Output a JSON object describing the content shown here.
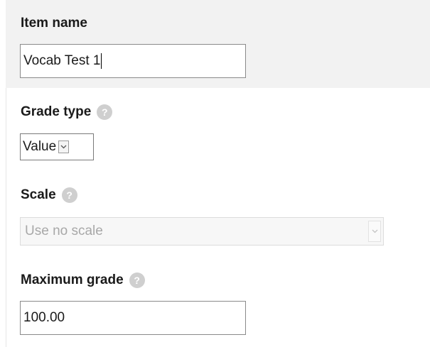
{
  "item_name": {
    "label": "Item name",
    "value": "Vocab Test 1"
  },
  "grade_type": {
    "label": "Grade type",
    "help_icon": "question-mark",
    "selected": "Value"
  },
  "scale": {
    "label": "Scale",
    "help_icon": "question-mark",
    "selected": "Use no scale",
    "disabled": true
  },
  "maximum_grade": {
    "label": "Maximum grade",
    "help_icon": "question-mark",
    "value": "100.00"
  },
  "colors": {
    "top_band": "#f2f2f2",
    "help_icon": "#cfcfcf",
    "disabled_text": "#a8a8a8"
  }
}
